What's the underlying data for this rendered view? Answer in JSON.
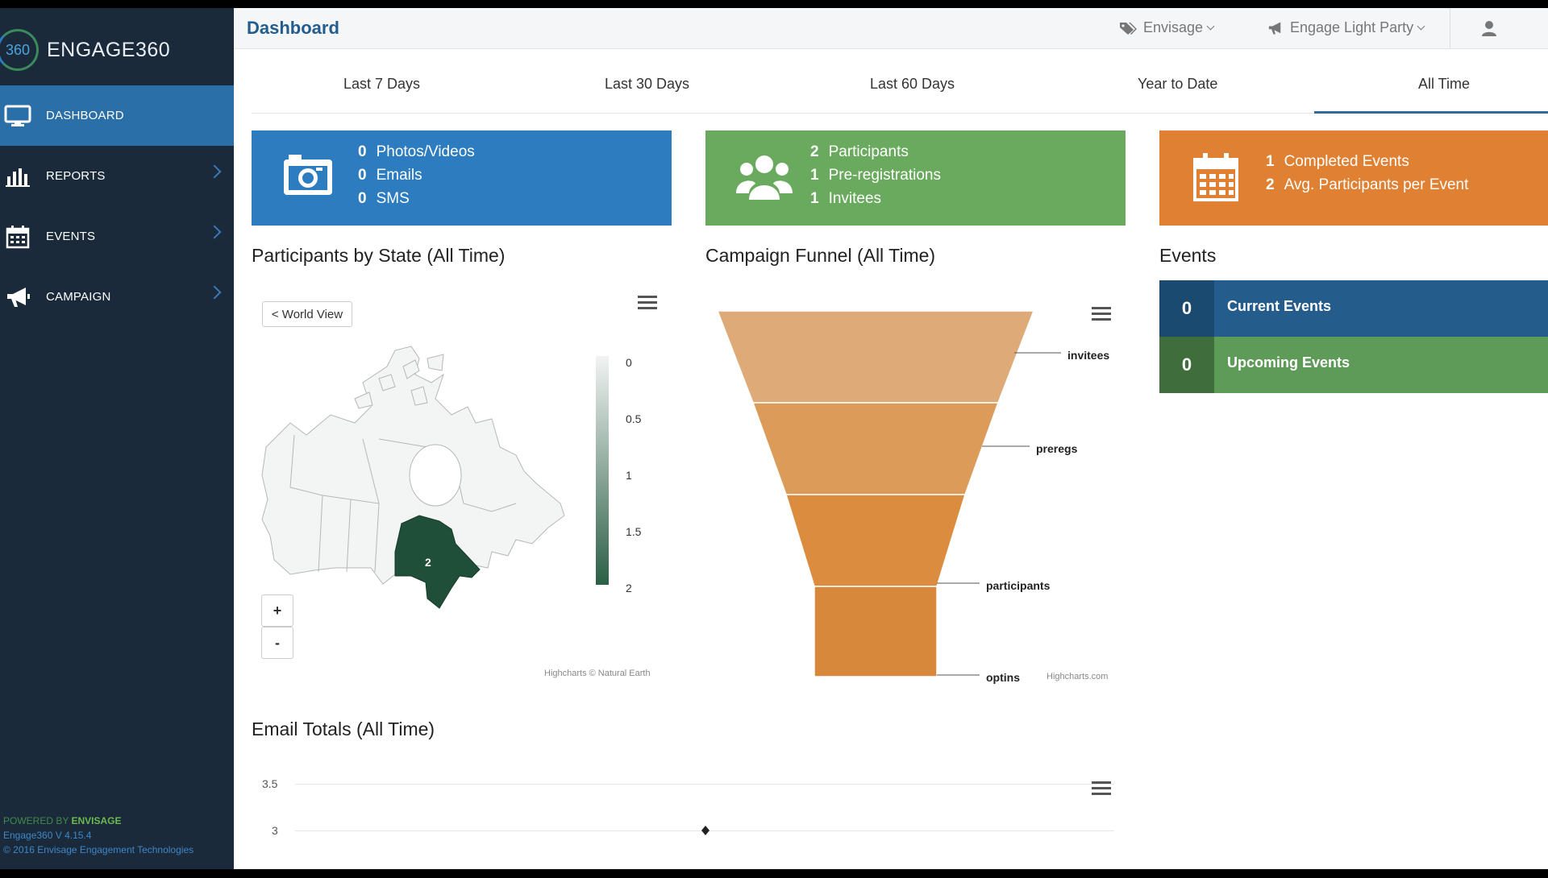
{
  "sidebar": {
    "brand_logo_text": "360",
    "brand_name": "ENGAGE360",
    "items": [
      {
        "label": "DASHBOARD",
        "icon": "monitor-icon",
        "active": true
      },
      {
        "label": "REPORTS",
        "icon": "bar-chart-icon",
        "active": false
      },
      {
        "label": "EVENTS",
        "icon": "calendar-icon",
        "active": false
      },
      {
        "label": "CAMPAIGN",
        "icon": "megaphone-icon",
        "active": false
      }
    ],
    "footer": {
      "powered_prefix": "POWERED BY ",
      "powered_brand": "ENVISAGE",
      "version": "Engage360 V 4.15.4",
      "copyright": "© 2016 Envisage Engagement Technologies"
    }
  },
  "header": {
    "title": "Dashboard",
    "org_label": "Envisage",
    "campaign_label": "Engage Light Party",
    "user_icon": "user-icon"
  },
  "tabs": [
    {
      "label": "Last 7 Days",
      "active": false
    },
    {
      "label": "Last 30 Days",
      "active": false
    },
    {
      "label": "Last 60 Days",
      "active": false
    },
    {
      "label": "Year to Date",
      "active": false
    },
    {
      "label": "All Time",
      "active": true
    }
  ],
  "stat_cards": [
    {
      "color": "#2c7cbf",
      "icon": "camera-icon",
      "lines": [
        {
          "num": "0",
          "label": "Photos/Videos"
        },
        {
          "num": "0",
          "label": "Emails"
        },
        {
          "num": "0",
          "label": "SMS"
        }
      ]
    },
    {
      "color": "#6aaa5e",
      "icon": "users-icon",
      "lines": [
        {
          "num": "2",
          "label": "Participants"
        },
        {
          "num": "1",
          "label": "Pre-registrations"
        },
        {
          "num": "1",
          "label": "Invitees"
        }
      ]
    },
    {
      "color": "#e08033",
      "icon": "calendar-icon",
      "lines": [
        {
          "num": "1",
          "label": "Completed Events"
        },
        {
          "num": "2",
          "label": "Avg. Participants per Event"
        }
      ]
    }
  ],
  "map_section": {
    "title": "Participants by State (All Time)",
    "world_view_button": "< World View",
    "zoom_in": "+",
    "zoom_out": "-",
    "region_value_label": "2",
    "legend_ticks": [
      "0",
      "0.5",
      "1",
      "1.5",
      "2"
    ],
    "legend_color_low": "#f1f3f2",
    "legend_color_high": "#2b5f46",
    "credit": "Highcharts © Natural Earth"
  },
  "funnel_section": {
    "title": "Campaign Funnel (All Time)",
    "credit": "Highcharts.com"
  },
  "events_section": {
    "title": "Events",
    "rows": [
      {
        "count": "0",
        "label": "Current Events",
        "color": "#245d8c",
        "dark": "#1b4a70"
      },
      {
        "count": "0",
        "label": "Upcoming Events",
        "color": "#5e9a58",
        "dark": "#3f6e3c"
      }
    ]
  },
  "email_section": {
    "title": "Email Totals (All Time)"
  },
  "chart_data": [
    {
      "type": "funnel",
      "categories": [
        "invitees",
        "preregs",
        "participants",
        "optins"
      ],
      "colors": [
        "#deaa78",
        "#dd9b5a",
        "#db8c3e",
        "#d8883a"
      ]
    },
    {
      "type": "line",
      "y_ticks": [
        "3.5",
        "3"
      ],
      "points": [
        {
          "y": 3
        }
      ]
    }
  ]
}
